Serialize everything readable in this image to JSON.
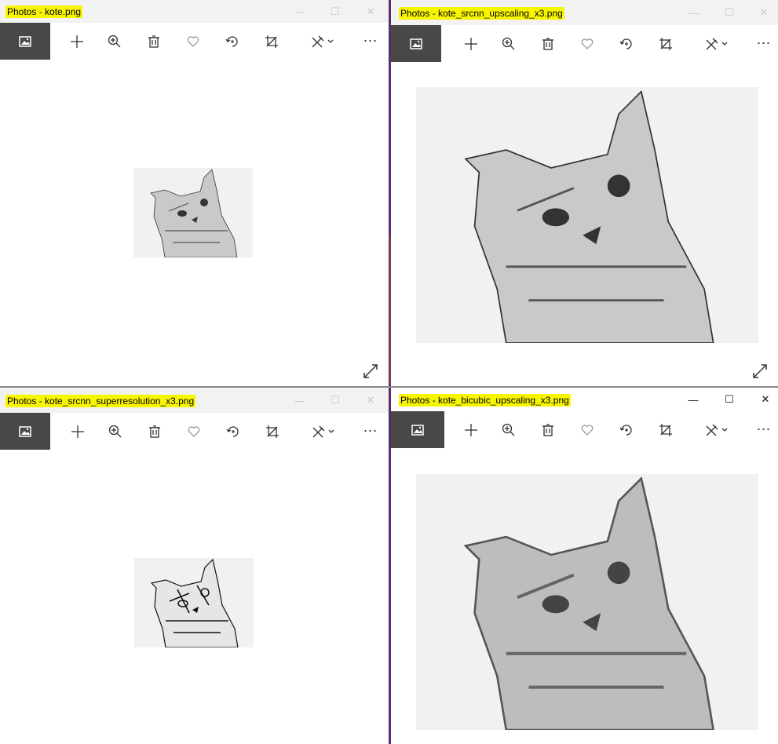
{
  "windows": [
    {
      "id": "w1",
      "title": "Photos - kote.png"
    },
    {
      "id": "w2",
      "title": "Photos - kote_srcnn_upscaling_x3.png"
    },
    {
      "id": "w3",
      "title": "Photos - kote_srcnn_superresolution_x3.png"
    },
    {
      "id": "w4",
      "title": "Photos - kote_bicubic_upscaling_x3.png"
    }
  ],
  "toolbar": {
    "buttons": [
      "view-all-photos",
      "add",
      "zoom",
      "delete",
      "favorite",
      "rotate",
      "crop",
      "edit-draw",
      "more"
    ],
    "more_label": "⋯"
  },
  "window_controls": {
    "minimize": "—",
    "maximize": "☐",
    "close": "✕"
  }
}
